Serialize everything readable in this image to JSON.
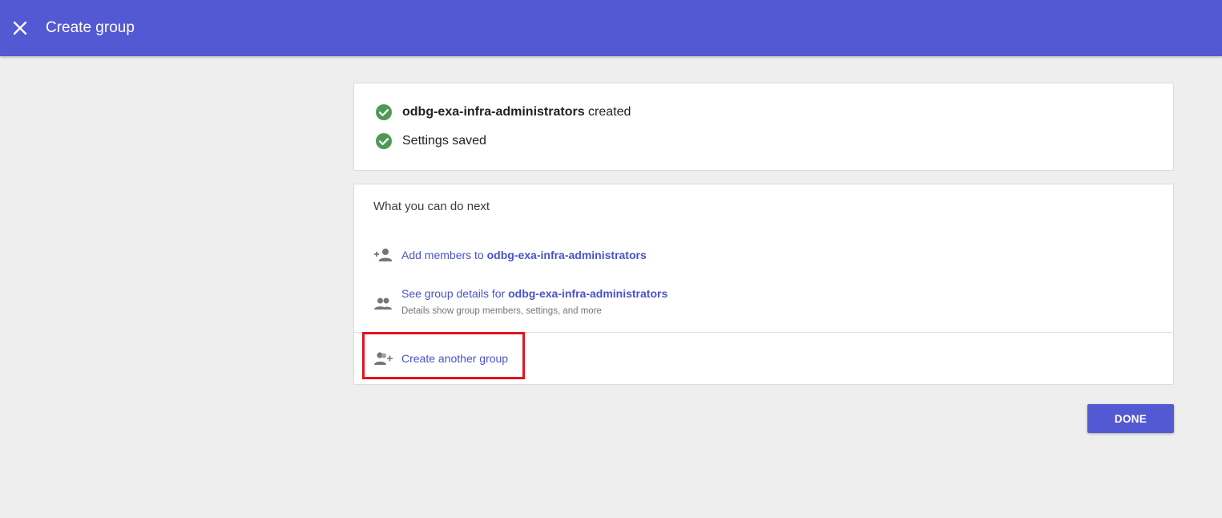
{
  "header": {
    "close_icon": "close-icon",
    "title": "Create group",
    "background_color": "#5359d3"
  },
  "status": {
    "items": [
      {
        "icon": "check-circle-icon",
        "group_name": "odbg-exa-infra-administrators",
        "suffix": " created"
      },
      {
        "icon": "check-circle-icon",
        "text": "Settings saved"
      }
    ],
    "check_color": "#4e9a55"
  },
  "next_steps": {
    "title": "What you can do next",
    "actions": [
      {
        "icon": "person-add-icon",
        "prefix": "Add members to ",
        "group_name": "odbg-exa-infra-administrators"
      },
      {
        "icon": "group-icon",
        "prefix": "See group details for ",
        "group_name": "odbg-exa-infra-administrators",
        "subtext": "Details show group members, settings, and more"
      },
      {
        "icon": "group-add-icon",
        "label": "Create another group"
      }
    ],
    "link_color": "#4a52c9"
  },
  "footer": {
    "done_label": "DONE"
  }
}
